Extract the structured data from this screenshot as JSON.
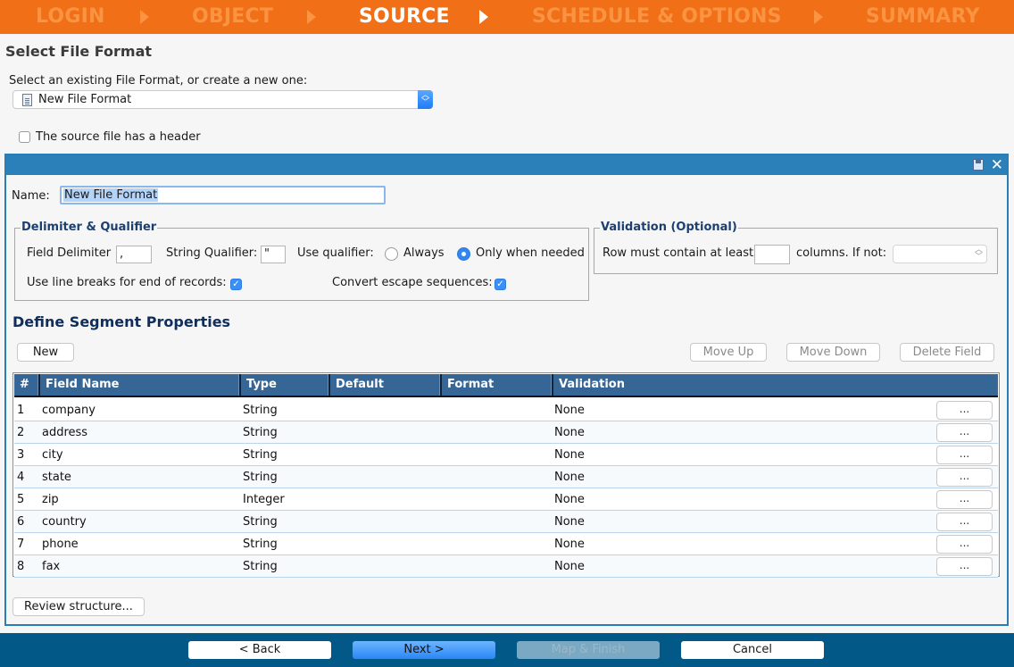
{
  "wizard": {
    "steps": [
      {
        "label": "LOGIN",
        "active": false
      },
      {
        "label": "OBJECT",
        "active": false
      },
      {
        "label": "SOURCE",
        "active": true
      },
      {
        "label": "SCHEDULE & OPTIONS",
        "active": false
      },
      {
        "label": "SUMMARY",
        "active": false
      }
    ],
    "colors": {
      "bar": "#f06f17",
      "inactive": "#fb9442",
      "active": "#ffffff"
    }
  },
  "file_format": {
    "section_title": "Select File Format",
    "select_label": "Select an existing File Format, or create a new one:",
    "selected_value": "New File Format",
    "selected_icon": "document-icon",
    "header_checkbox_label": "The source file has a header",
    "header_checked": false
  },
  "panel": {
    "icons": [
      "save-icon",
      "close-icon"
    ],
    "close_glyph": "✕",
    "name_label": "Name:",
    "name_value": "New File Format",
    "delimiter_group": {
      "title": "Delimiter & Qualifier",
      "field_delimiter_label": "Field Delimiter",
      "field_delimiter_value": ",",
      "string_qualifier_label": "String Qualifier:",
      "string_qualifier_value": "\"",
      "use_qualifier_label": "Use qualifier:",
      "options": [
        {
          "label": "Always",
          "selected": false
        },
        {
          "label": "Only when needed",
          "selected": true
        }
      ],
      "line_breaks_label": "Use line breaks for end of records:",
      "line_breaks_checked": true,
      "escape_label": "Convert escape sequences:",
      "escape_checked": true
    },
    "validation_group": {
      "title": "Validation (Optional)",
      "row_min_label": "Row must contain at least",
      "row_min_value": "",
      "if_not_label": "columns. If not:",
      "if_not_value": ""
    },
    "segment": {
      "title": "Define Segment Properties",
      "buttons": {
        "new": "New",
        "move_up": "Move Up",
        "move_down": "Move Down",
        "delete_field": "Delete Field"
      },
      "columns": [
        "#",
        "Field Name",
        "Type",
        "Default",
        "Format",
        "Validation"
      ],
      "rows": [
        {
          "num": "1",
          "name": "company",
          "type": "String",
          "default": "",
          "format": "",
          "validation": "None",
          "action": "..."
        },
        {
          "num": "2",
          "name": "address",
          "type": "String",
          "default": "",
          "format": "",
          "validation": "None",
          "action": "..."
        },
        {
          "num": "3",
          "name": "city",
          "type": "String",
          "default": "",
          "format": "",
          "validation": "None",
          "action": "..."
        },
        {
          "num": "4",
          "name": "state",
          "type": "String",
          "default": "",
          "format": "",
          "validation": "None",
          "action": "..."
        },
        {
          "num": "5",
          "name": "zip",
          "type": "Integer",
          "default": "",
          "format": "",
          "validation": "None",
          "action": "..."
        },
        {
          "num": "6",
          "name": "country",
          "type": "String",
          "default": "",
          "format": "",
          "validation": "None",
          "action": "..."
        },
        {
          "num": "7",
          "name": "phone",
          "type": "String",
          "default": "",
          "format": "",
          "validation": "None",
          "action": "..."
        },
        {
          "num": "8",
          "name": "fax",
          "type": "String",
          "default": "",
          "format": "",
          "validation": "None",
          "action": "..."
        }
      ]
    },
    "review_button": "Review structure..."
  },
  "footer": {
    "back": "< Back",
    "next": "Next >",
    "map_finish": "Map & Finish",
    "cancel": "Cancel"
  }
}
